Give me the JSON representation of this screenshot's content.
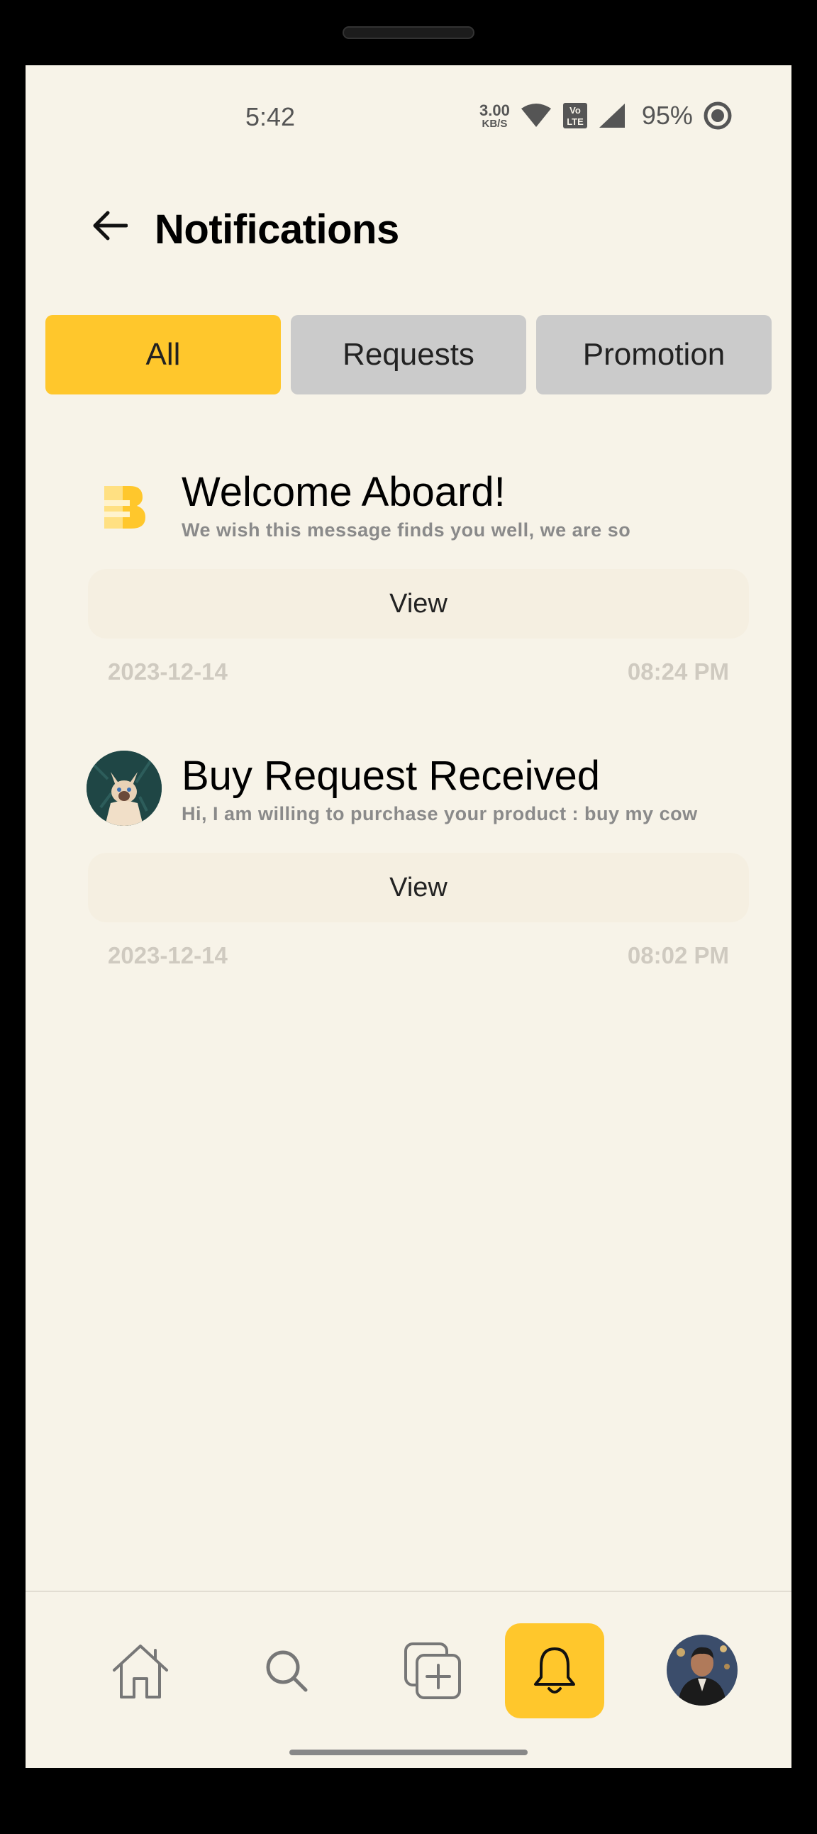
{
  "status_bar": {
    "time": "5:42",
    "net_speed_value": "3.00",
    "net_speed_unit": "KB/S",
    "volte": "Vo LTE",
    "battery": "95%"
  },
  "header": {
    "title": "Notifications"
  },
  "tabs": [
    {
      "label": "All",
      "active": true
    },
    {
      "label": "Requests",
      "active": false
    },
    {
      "label": "Promotion",
      "active": false
    }
  ],
  "notifications": [
    {
      "title": "Welcome Aboard!",
      "message": "We wish this message finds you well, we are so",
      "view_label": "View",
      "date": "2023-12-14",
      "time": "08:24 PM"
    },
    {
      "title": "Buy Request Received",
      "message": "Hi, I am willing to purchase your product : buy my cow",
      "view_label": "View",
      "date": "2023-12-14",
      "time": "08:02 PM"
    }
  ],
  "bottom_nav": {
    "items": [
      {
        "icon": "home-icon"
      },
      {
        "icon": "search-icon"
      },
      {
        "icon": "add-post-icon"
      },
      {
        "icon": "bell-icon",
        "active": true
      },
      {
        "icon": "profile-avatar"
      }
    ]
  },
  "colors": {
    "accent": "#ffc72c",
    "background": "#f7f3e8",
    "tab_inactive": "#cbcbcb"
  }
}
